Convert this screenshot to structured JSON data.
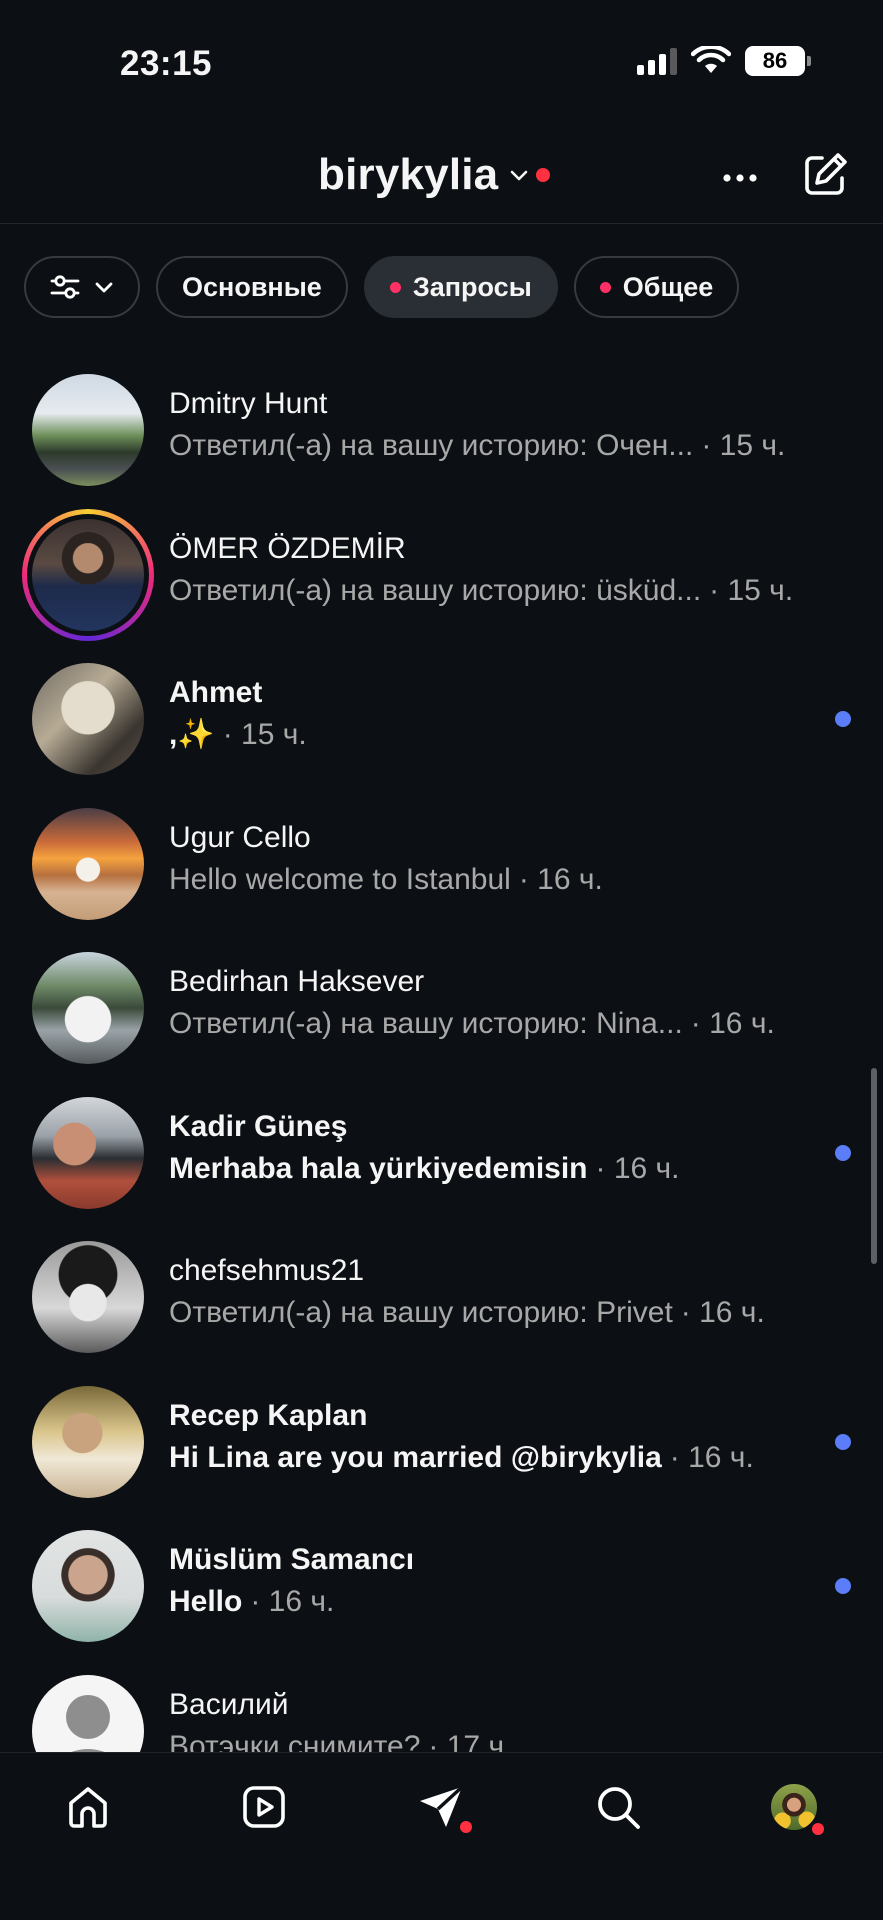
{
  "status_bar": {
    "time": "23:15",
    "battery": "86"
  },
  "header": {
    "username": "birykylia"
  },
  "filters": [
    {
      "label": "Основные",
      "dot": false,
      "active": false
    },
    {
      "label": "Запросы",
      "dot": true,
      "active": true
    },
    {
      "label": "Общее",
      "dot": true,
      "active": false
    }
  ],
  "threads": [
    {
      "name": "Dmitry Hunt",
      "message": "Ответил(-а) на вашу историю: Очен...",
      "time": "· 15 ч.",
      "unread": false
    },
    {
      "name": "ÖMER ÖZDEMİR",
      "message": "Ответил(-а) на вашу историю: üsküd...",
      "time": "· 15 ч.",
      "unread": false
    },
    {
      "name": "Ahmet",
      "message": ",✨",
      "time": "· 15 ч.",
      "unread": true
    },
    {
      "name": "Ugur Cello",
      "message": "Hello welcome to Istanbul",
      "time": "· 16 ч.",
      "unread": false
    },
    {
      "name": "Bedirhan Haksever",
      "message": "Ответил(-а) на вашу историю: Nina...",
      "time": "· 16 ч.",
      "unread": false
    },
    {
      "name": "Kadir Güneş",
      "message": "Merhaba hala yürkiyedemisin",
      "time": "· 16 ч.",
      "unread": true
    },
    {
      "name": "chefsehmus21",
      "message": "Ответил(-а) на вашу историю: Privet",
      "time": "· 16 ч.",
      "unread": false
    },
    {
      "name": "Recep Kaplan",
      "message": "Hi Lina are you married @birykylia",
      "time": "· 16 ч.",
      "unread": true
    },
    {
      "name": "Müslüm Samancı",
      "message": "Hello",
      "time": "· 16 ч.",
      "unread": true
    },
    {
      "name": "Василий",
      "message": "Вотэчки снимите?",
      "time": "· 17 ч.",
      "unread": false
    }
  ],
  "nav": {
    "items": [
      "home-icon",
      "reels-icon",
      "direct-icon",
      "search-icon",
      "profile-avatar"
    ]
  },
  "colors": {
    "background": "#0c1014",
    "unread_dot": "#5b7ef8",
    "notification": "#ff3040",
    "muted_text": "#a8a8a8"
  }
}
